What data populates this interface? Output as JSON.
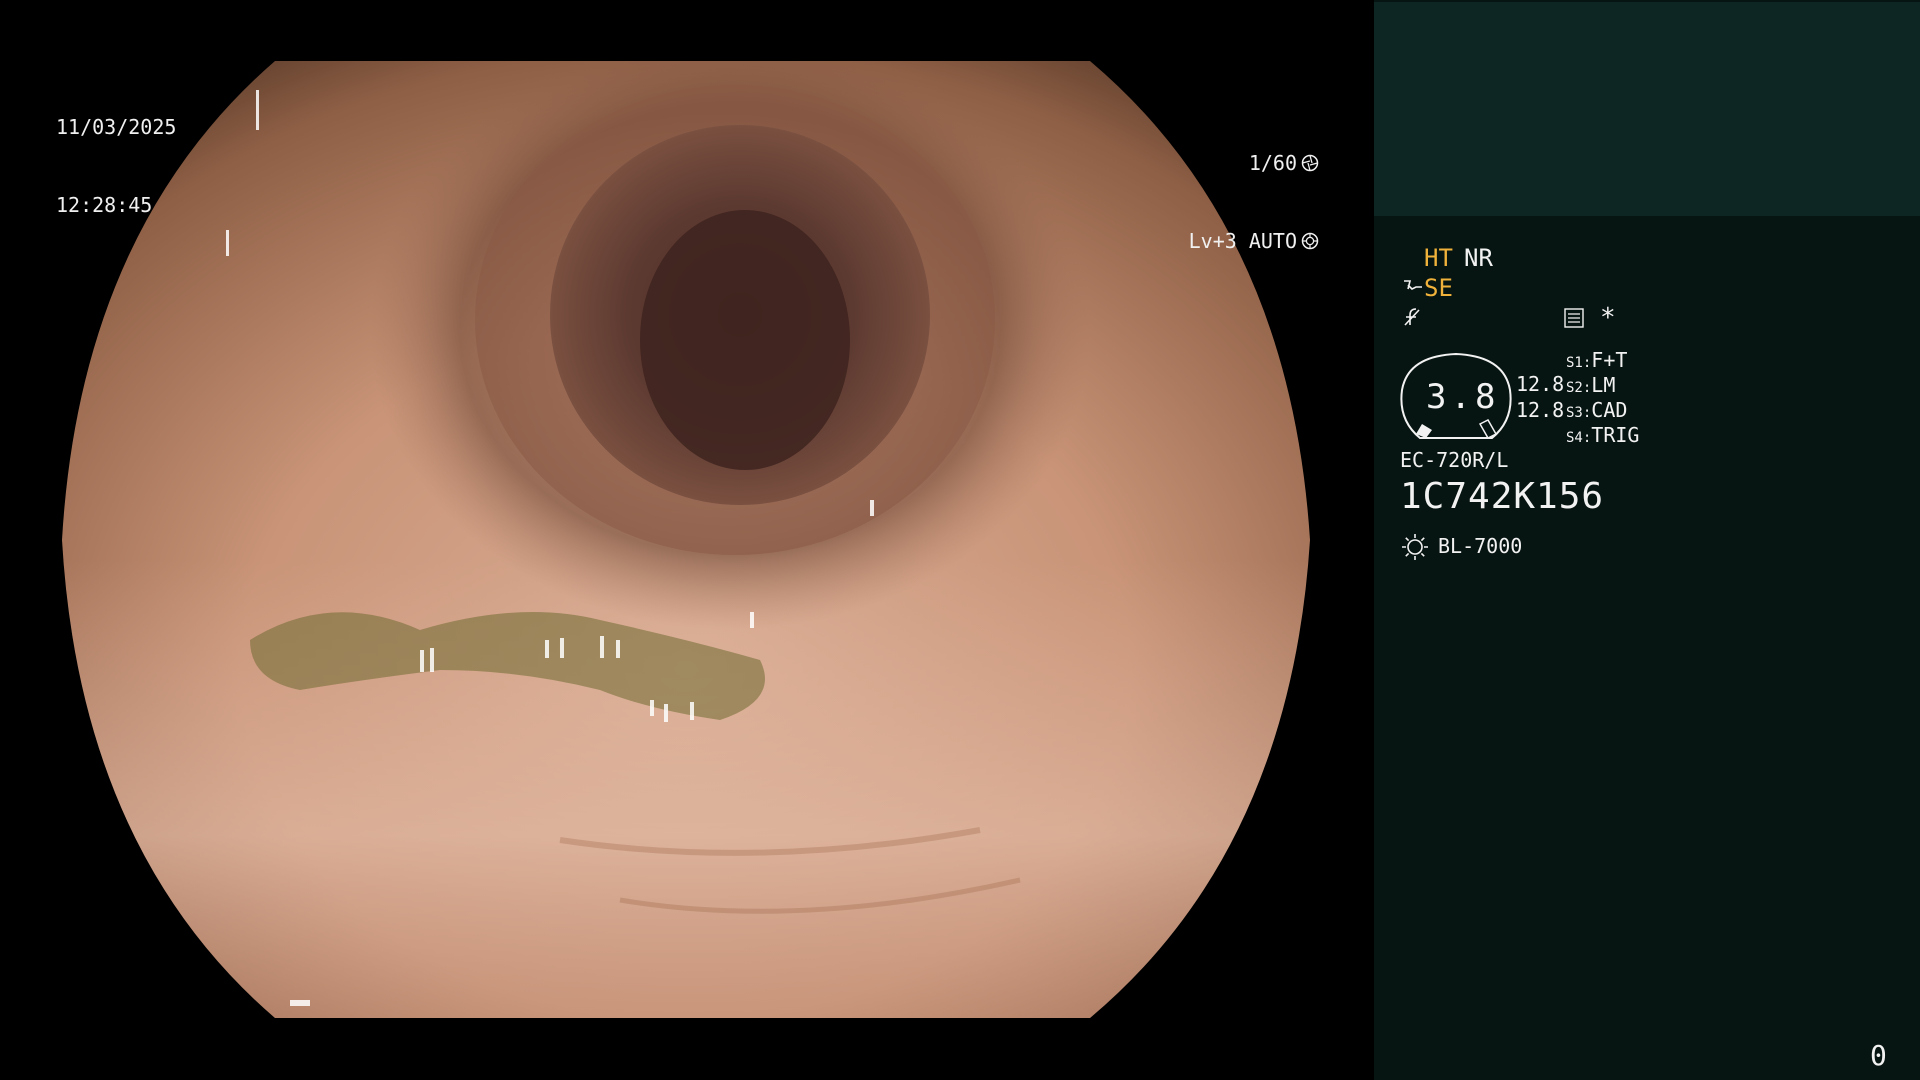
{
  "overlay": {
    "date": "11/03/2025",
    "time": "12:28:45",
    "shutter": "1/60",
    "level": "Lv+3 AUTO",
    "icons": [
      "shutter-icon",
      "iris-icon"
    ]
  },
  "panel": {
    "ht": "HT",
    "nr": "NR",
    "se": "SE",
    "star": "*",
    "gauge_value": "3.8",
    "value_a": "12.8",
    "value_b": "12.8",
    "switches": [
      {
        "key": "S1:",
        "value": "F+T"
      },
      {
        "key": "S2:",
        "value": "LM"
      },
      {
        "key": "S3:",
        "value": "CAD"
      },
      {
        "key": "S4:",
        "value": "TRIG"
      }
    ],
    "model": "EC-720R/L",
    "serial": "1C742K156",
    "light_source": "BL-7000",
    "counter": "0",
    "colors": {
      "accent": "#f0b23a",
      "panel_bg": "#071512",
      "panel_header": "#0e2623"
    }
  }
}
